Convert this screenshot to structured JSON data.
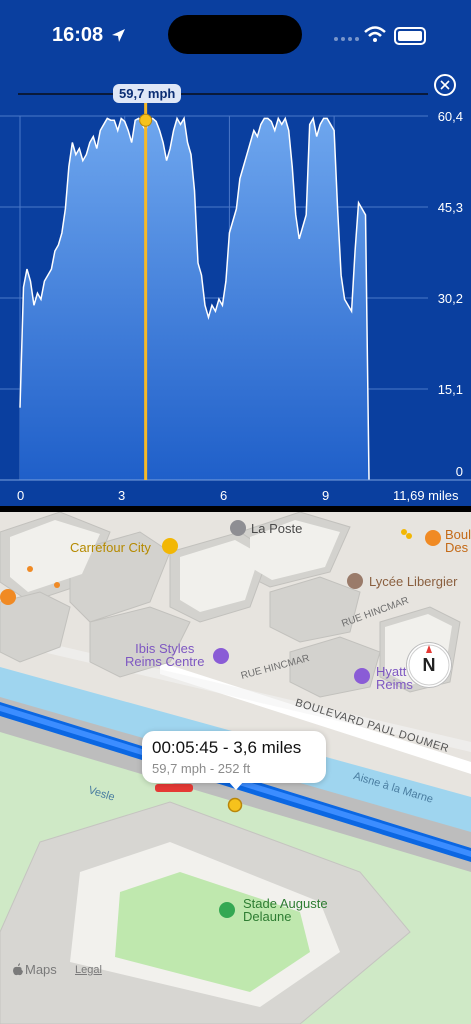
{
  "status_bar": {
    "time": "16:08"
  },
  "chart_data": {
    "type": "area",
    "title": "",
    "xlabel": "",
    "ylabel": "",
    "x": [
      0,
      0.1,
      0.2,
      0.3,
      0.4,
      0.5,
      0.6,
      0.7,
      0.8,
      0.9,
      1.0,
      1.1,
      1.2,
      1.3,
      1.4,
      1.5,
      1.6,
      1.7,
      1.8,
      1.9,
      2.0,
      2.1,
      2.2,
      2.3,
      2.4,
      2.5,
      2.6,
      2.7,
      2.8,
      2.9,
      3.0,
      3.1,
      3.2,
      3.3,
      3.4,
      3.5,
      3.6,
      3.7,
      3.8,
      3.9,
      4.0,
      4.1,
      4.2,
      4.3,
      4.4,
      4.5,
      4.6,
      4.7,
      4.8,
      4.9,
      5.0,
      5.1,
      5.2,
      5.3,
      5.4,
      5.5,
      5.6,
      5.7,
      5.8,
      5.9,
      6.0,
      6.1,
      6.2,
      6.3,
      6.4,
      6.5,
      6.6,
      6.7,
      6.8,
      6.9,
      7.0,
      7.1,
      7.2,
      7.3,
      7.4,
      7.5,
      7.6,
      7.7,
      7.8,
      7.9,
      8.0,
      8.1,
      8.2,
      8.3,
      8.4,
      8.5,
      8.6,
      8.7,
      8.8,
      8.9,
      9.0,
      9.1,
      9.2,
      9.3,
      9.4,
      9.5,
      9.6,
      9.7,
      9.8,
      9.9,
      10.0,
      10.1,
      10.2,
      10.3,
      10.4,
      10.5,
      10.6,
      10.7,
      10.8,
      10.9,
      11.0,
      11.1,
      11.2,
      11.3,
      11.4,
      11.5,
      11.6,
      11.69
    ],
    "series": [
      {
        "values": [
          12,
          32,
          35,
          33,
          29,
          31,
          30,
          33,
          34,
          35,
          38,
          39,
          41,
          45,
          52,
          56,
          54,
          55,
          53,
          54,
          56,
          57,
          55,
          58,
          59,
          60,
          59.7,
          59.7,
          58,
          60,
          59.5,
          58,
          56,
          59.7,
          60,
          59,
          58,
          59.7,
          60,
          59.5,
          58,
          56,
          53,
          55,
          58,
          60,
          59,
          60,
          56,
          54,
          48,
          36,
          34,
          29,
          27,
          29,
          28,
          30,
          29,
          33,
          41,
          43,
          45,
          50,
          52,
          54,
          56,
          58,
          57,
          59,
          60,
          60,
          59.5,
          58,
          60,
          59,
          60,
          58,
          52,
          44,
          40,
          42,
          44,
          59,
          60,
          57,
          59,
          60,
          60,
          59,
          58,
          45,
          34,
          30,
          29,
          28,
          38,
          46,
          45,
          44,
          0
        ]
      }
    ],
    "x_ticks": [
      "0",
      "3",
      "6",
      "9",
      "11,69 miles"
    ],
    "y_ticks": [
      "0",
      "15,1",
      "30,2",
      "45,3",
      "60,4"
    ],
    "ylim": [
      0,
      60.4
    ],
    "xlim": [
      0,
      11.69
    ],
    "grid": true,
    "cursor_value_label": "59,7 mph",
    "cursor_x": 3.6
  },
  "map": {
    "labels": {
      "la_poste": "La Poste",
      "carrefour": "Carrefour City",
      "lycee": "Lycée Libergier",
      "ibis": "Ibis Styles\nReims Centre",
      "hyatt": "Hyatt\nReims",
      "rue_hincmar_1": "RUE HINCMAR",
      "rue_hincmar_2": "RUE HINCMAR",
      "boulevard": "BOULEVARD PAUL DOUMER",
      "vesle": "Vesle",
      "canal": "Aisne à la Marne",
      "stade": "Stade Auguste\nDelaune",
      "boul": "Boul\nDes"
    },
    "compass_letter": "N",
    "info": {
      "title": "00:05:45 - 3,6 miles",
      "subtitle": "59,7 mph - 252 ft"
    },
    "footer": {
      "brand": "Maps",
      "legal": "Legal"
    }
  }
}
